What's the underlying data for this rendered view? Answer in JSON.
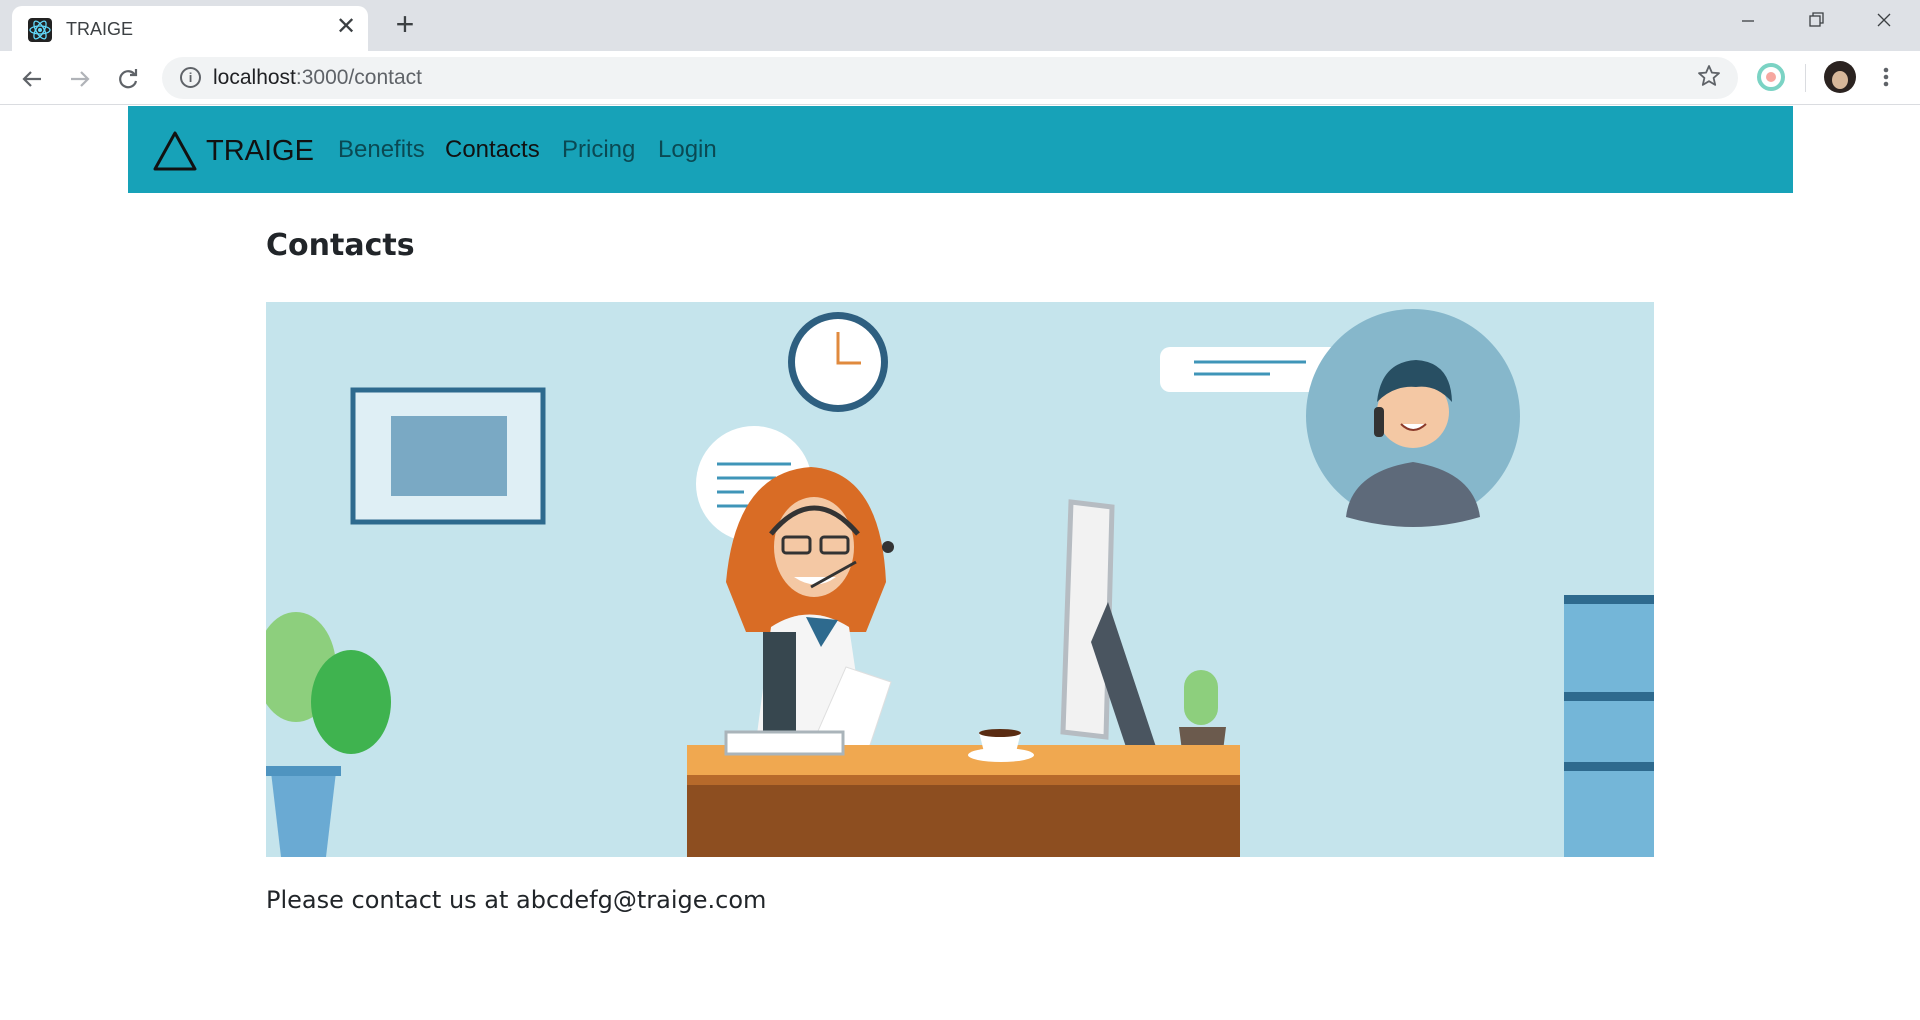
{
  "browser": {
    "tab_title": "TRAIGE",
    "tab_close": "✕",
    "new_tab": "+",
    "url_host": "localhost",
    "url_path": ":3000/contact",
    "icons": [
      "react-favicon-icon",
      "back-arrow-icon",
      "forward-arrow-icon",
      "reload-icon",
      "info-icon",
      "star-icon",
      "extension-icon",
      "avatar",
      "menu-icon"
    ]
  },
  "navbar": {
    "brand": "TRAIGE",
    "links": [
      {
        "label": "Benefits",
        "active": false
      },
      {
        "label": "Contacts",
        "active": true
      },
      {
        "label": "Pricing",
        "active": false
      },
      {
        "label": "Login",
        "active": false
      }
    ],
    "color": "#17a2b8"
  },
  "main": {
    "title": "Contacts",
    "contact_line": "Please contact us at abcdefg@traige.com"
  },
  "illustration": {
    "subject": "customer-support-agent-illustration",
    "background": "#c5e4ec"
  }
}
